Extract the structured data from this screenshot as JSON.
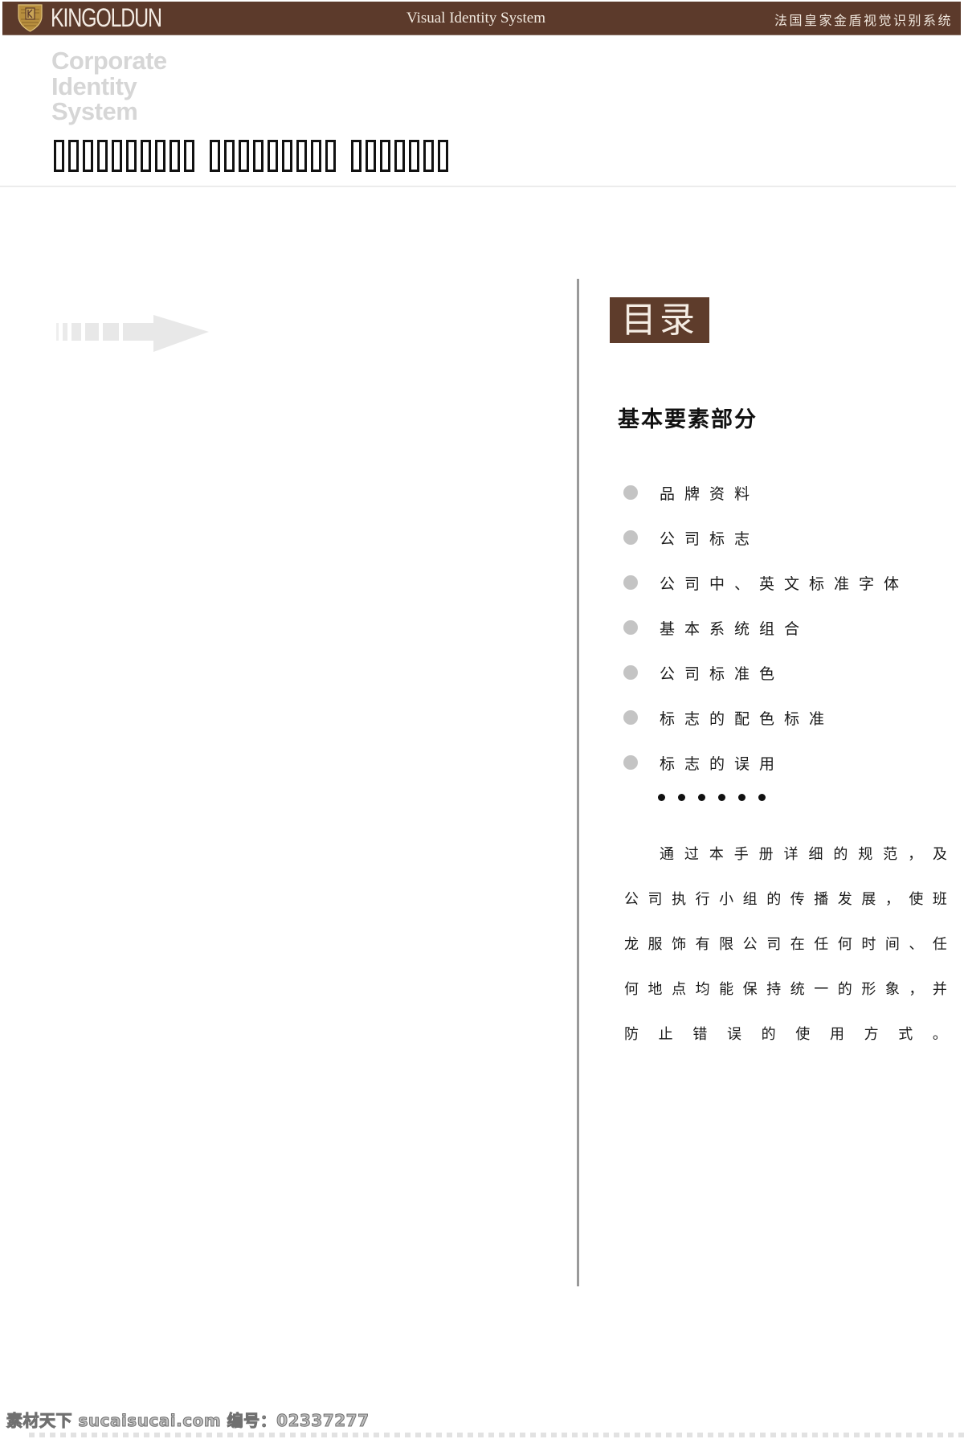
{
  "header": {
    "brand": "KINGOLDUN",
    "center_title": "Visual Identity System",
    "right_title": "法国皇家金盾视觉识别系统",
    "logo_icon": "shield-logo-icon",
    "bar_color": "#5c3a2b"
  },
  "title_block": {
    "watermark_lines": [
      "Corporate",
      "Identity",
      "System"
    ],
    "title_missing_glyph_words": [
      10,
      9,
      7
    ]
  },
  "decor": {
    "arrow_icon": "dashed-arrow-right-icon"
  },
  "toc": {
    "badge": "目录",
    "badge_color": "#5e3c2b",
    "section_heading": "基本要素部分",
    "items": [
      {
        "label": "品牌资料"
      },
      {
        "label": "公司标志"
      },
      {
        "label": "公司中、英文标准字体"
      },
      {
        "label": "基本系统组合"
      },
      {
        "label": "公司标准色"
      },
      {
        "label": "标志的配色标准"
      },
      {
        "label": "标志的误用"
      }
    ],
    "ellipsis_dots": 6,
    "paragraph_lines": [
      "通过本手册详细的规范，及",
      "公司执行小组的传播发展，使班",
      "龙服饰有限公司在任何时间、任",
      "何地点均能保持统一的形象，并",
      "防止错误的使用方式。"
    ]
  },
  "watermark": {
    "text": "素材天下 sucaisucai.com  编号：02337277"
  }
}
